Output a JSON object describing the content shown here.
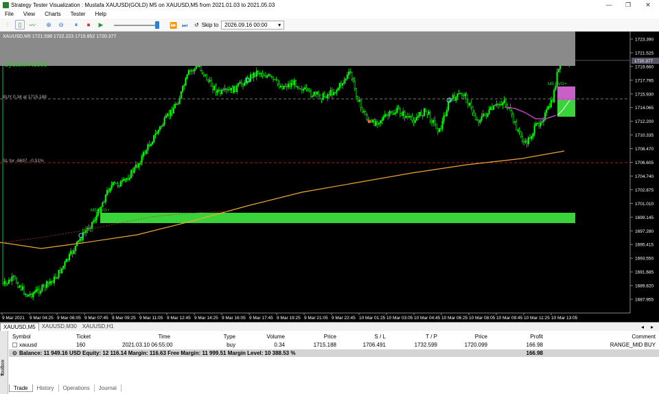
{
  "window": {
    "title": "Strategy Tester Visualization : Mustafa XAUUSD(GOLD) M5 on XAUUSD,M5 from 2021.01.03 to 2021.05.03",
    "controls": [
      "—",
      "❐",
      "✕"
    ]
  },
  "menu": [
    "File",
    "View",
    "Charts",
    "Tester",
    "Help"
  ],
  "toolbar": {
    "skip_label": "Skip to",
    "skip_date": "2026.09.16 00:00"
  },
  "chart": {
    "info_line": "XAUUSD,M5  1721.598 1722.223 1719.852 1720.377",
    "system_status": "System Active",
    "buy_label": "BUY 0.34 at 1715.188",
    "sl_label": "SL for -8697, -0.51%",
    "m5_label_left": "M5 FVG+",
    "m5_label_right": "M5 FVG+",
    "current_price": "1720.377",
    "price_ticks": [
      "1723.390",
      "1721.525",
      "1719.660",
      "1717.795",
      "1715.930",
      "1714.065",
      "1712.200",
      "1710.335",
      "1708.470",
      "1706.605",
      "1704.740",
      "1702.875",
      "1701.010",
      "1699.145",
      "1697.280",
      "1695.415",
      "1693.550",
      "1691.685",
      "1689.820",
      "1687.955"
    ],
    "time_ticks": [
      "9 Mar 2021",
      "9 Mar 04:25",
      "9 Mar 06:05",
      "9 Mar 07:45",
      "9 Mar 09:25",
      "9 Mar 11:05",
      "9 Mar 12:45",
      "9 Mar 14:25",
      "9 Mar 16:05",
      "9 Mar 17:45",
      "9 Mar 19:25",
      "9 Mar 21:05",
      "9 Mar 22:45",
      "10 Mar 01:25",
      "10 Mar 03:05",
      "10 Mar 04:45",
      "10 Mar 06:25",
      "10 Mar 08:05",
      "10 Mar 09:45",
      "10 Mar 11:25",
      "10 Mar 13:05"
    ],
    "colors": {
      "bull": "#00ff00",
      "bear": "#00ff00",
      "bg": "#000000",
      "ma": "#f0a830",
      "zone": "#39d43a",
      "magenta_zone": "#c860c8"
    }
  },
  "chart_tabs": [
    "XAUUSD,M5",
    "XAUUSD,M30",
    "XAUUSD,H1"
  ],
  "trade": {
    "headers": [
      "Symbol",
      "Ticket",
      "Time",
      "Type",
      "Volume",
      "Price",
      "S / L",
      "T / P",
      "Price",
      "Profit",
      "Comment"
    ],
    "row": [
      "xauusd",
      "160",
      "2021.03.10 06:55:00",
      "buy",
      "0.34",
      "1715.188",
      "1706.491",
      "1732.599",
      "1720.099",
      "166.98",
      "RANGE_MID BUY"
    ],
    "balance_text": "Balance: 11 949.16 USD  Equity: 12 116.14  Margin: 116.63  Free Margin: 11 999.51  Margin Level: 10 388.53 %",
    "balance_profit": "166.98"
  },
  "bottom_tabs": [
    "Trade",
    "History",
    "Operations",
    "Journal"
  ],
  "toolbox_label": "Toolbox"
}
